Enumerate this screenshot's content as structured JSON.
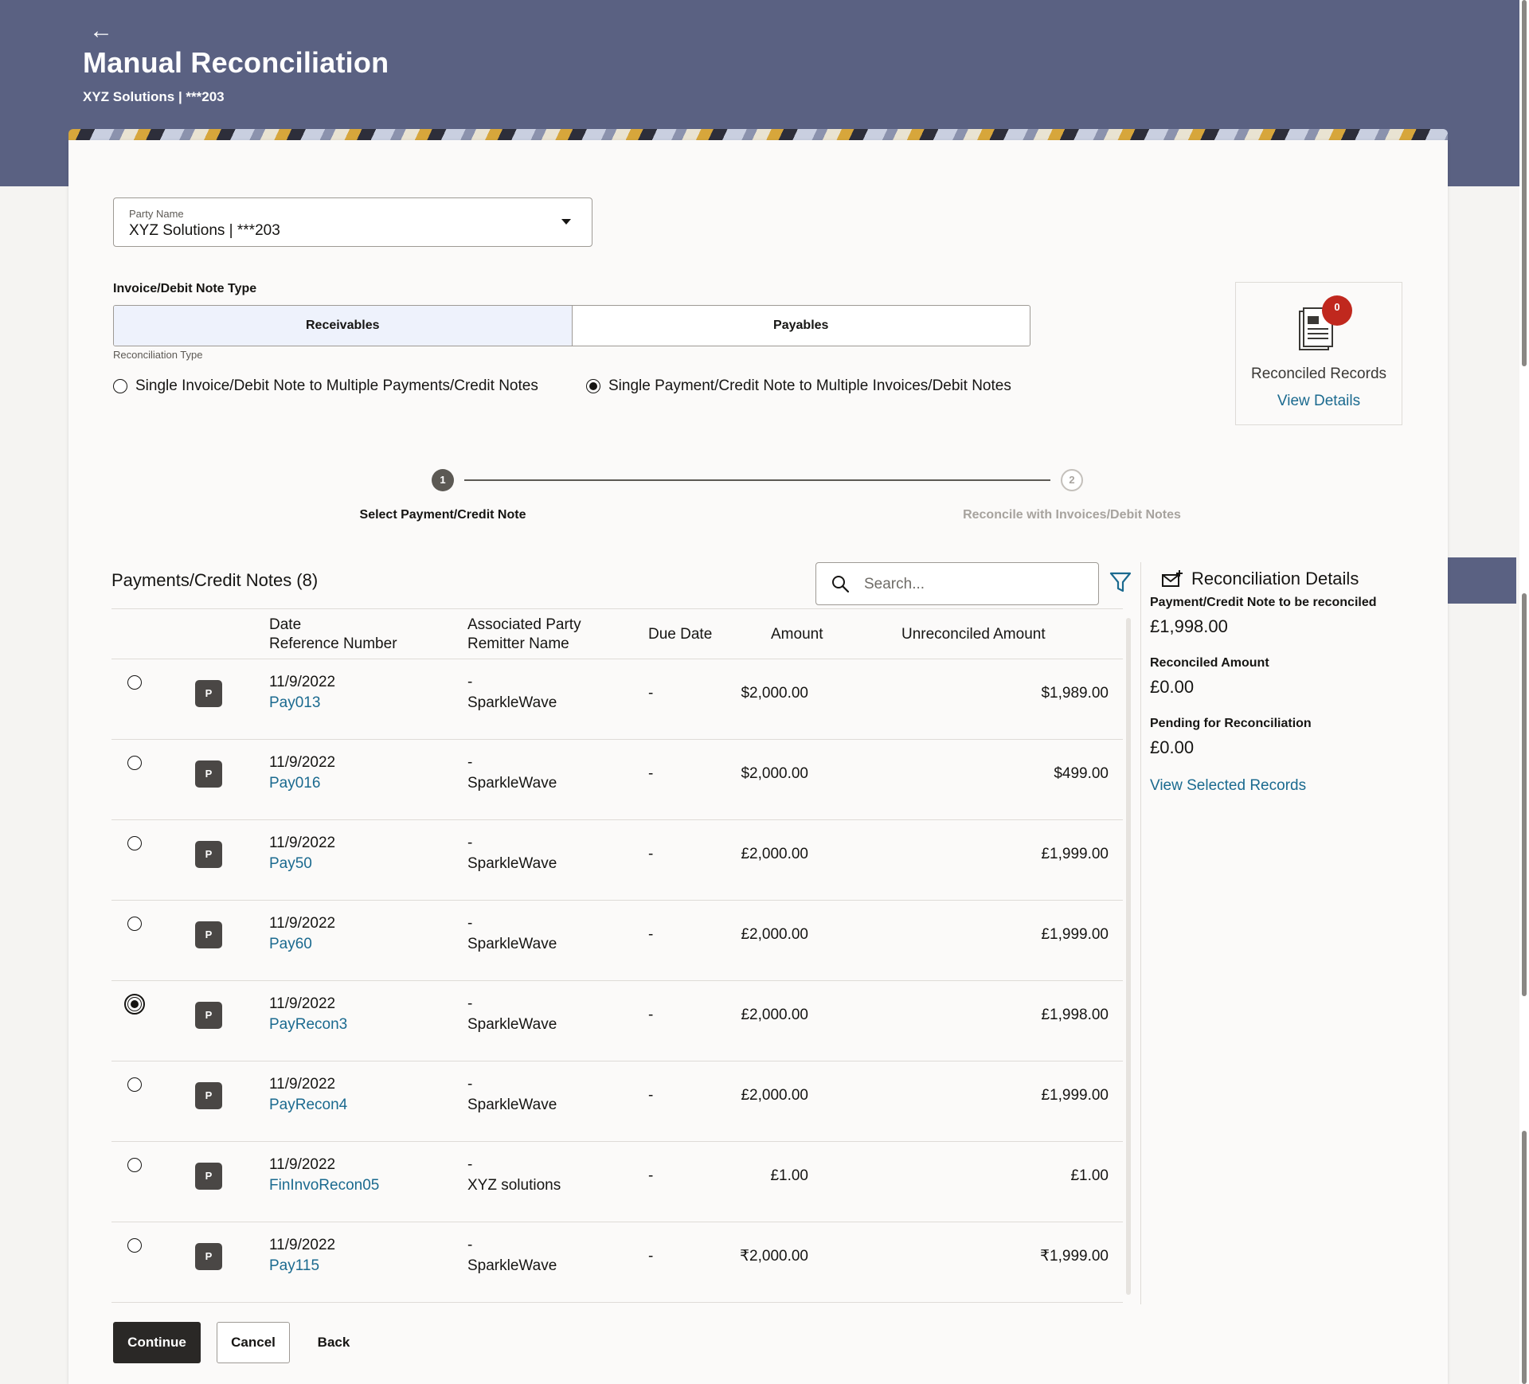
{
  "header": {
    "title": "Manual Reconciliation",
    "subtitle": "XYZ Solutions | ***203",
    "back_icon": "arrow-left-icon"
  },
  "party": {
    "label": "Party Name",
    "value": "XYZ Solutions | ***203"
  },
  "invoice_type": {
    "label": "Invoice/Debit Note Type",
    "options": [
      "Receivables",
      "Payables"
    ],
    "selected": "Receivables"
  },
  "recon_type": {
    "label": "Reconciliation Type",
    "options": [
      "Single Invoice/Debit Note to Multiple Payments/Credit Notes",
      "Single Payment/Credit Note to Multiple Invoices/Debit Notes"
    ],
    "selected_index": 1
  },
  "reconciled_records": {
    "count": "0",
    "title": "Reconciled Records",
    "link": "View Details"
  },
  "stepper": {
    "steps": [
      {
        "number": "1",
        "label": "Select Payment/Credit Note"
      },
      {
        "number": "2",
        "label": "Reconcile with Invoices/Debit Notes"
      }
    ]
  },
  "list": {
    "title": "Payments/Credit Notes (8)",
    "search_placeholder": "Search...",
    "headers": {
      "date": "Date",
      "ref": "Reference Number",
      "assoc": "Associated Party",
      "remitter": "Remitter Name",
      "due": "Due Date",
      "amount": "Amount",
      "unreconciled": "Unreconciled Amount"
    },
    "rows": [
      {
        "tag": "P",
        "date": "11/9/2022",
        "ref": "Pay013",
        "assoc": "-",
        "remitter": "SparkleWave",
        "due": "-",
        "amount": "$2,000.00",
        "unreconciled": "$1,989.00",
        "selected": false
      },
      {
        "tag": "P",
        "date": "11/9/2022",
        "ref": "Pay016",
        "assoc": "-",
        "remitter": "SparkleWave",
        "due": "-",
        "amount": "$2,000.00",
        "unreconciled": "$499.00",
        "selected": false
      },
      {
        "tag": "P",
        "date": "11/9/2022",
        "ref": "Pay50",
        "assoc": "-",
        "remitter": "SparkleWave",
        "due": "-",
        "amount": "£2,000.00",
        "unreconciled": "£1,999.00",
        "selected": false
      },
      {
        "tag": "P",
        "date": "11/9/2022",
        "ref": "Pay60",
        "assoc": "-",
        "remitter": "SparkleWave",
        "due": "-",
        "amount": "£2,000.00",
        "unreconciled": "£1,999.00",
        "selected": false
      },
      {
        "tag": "P",
        "date": "11/9/2022",
        "ref": "PayRecon3",
        "assoc": "-",
        "remitter": "SparkleWave",
        "due": "-",
        "amount": "£2,000.00",
        "unreconciled": "£1,998.00",
        "selected": true
      },
      {
        "tag": "P",
        "date": "11/9/2022",
        "ref": "PayRecon4",
        "assoc": "-",
        "remitter": "SparkleWave",
        "due": "-",
        "amount": "£2,000.00",
        "unreconciled": "£1,999.00",
        "selected": false
      },
      {
        "tag": "P",
        "date": "11/9/2022",
        "ref": "FinInvoRecon05",
        "assoc": "-",
        "remitter": "XYZ solutions",
        "due": "-",
        "amount": "£1.00",
        "unreconciled": "£1.00",
        "selected": false
      },
      {
        "tag": "P",
        "date": "11/9/2022",
        "ref": "Pay115",
        "assoc": "-",
        "remitter": "SparkleWave",
        "due": "-",
        "amount": "₹2,000.00",
        "unreconciled": "₹1,999.00",
        "selected": false
      }
    ]
  },
  "recon_details": {
    "title": "Reconciliation Details",
    "to_be_reconciled_label": "Payment/Credit Note to be reconciled",
    "to_be_reconciled_value": "£1,998.00",
    "reconciled_label": "Reconciled Amount",
    "reconciled_value": "£0.00",
    "pending_label": "Pending for Reconciliation",
    "pending_value": "£0.00",
    "link": "View Selected Records"
  },
  "actions": {
    "continue": "Continue",
    "cancel": "Cancel",
    "back": "Back"
  },
  "colors": {
    "banner": "#5a6182",
    "link": "#1b6a8f",
    "badge": "#c0281e",
    "primary_button": "#2a2826"
  }
}
